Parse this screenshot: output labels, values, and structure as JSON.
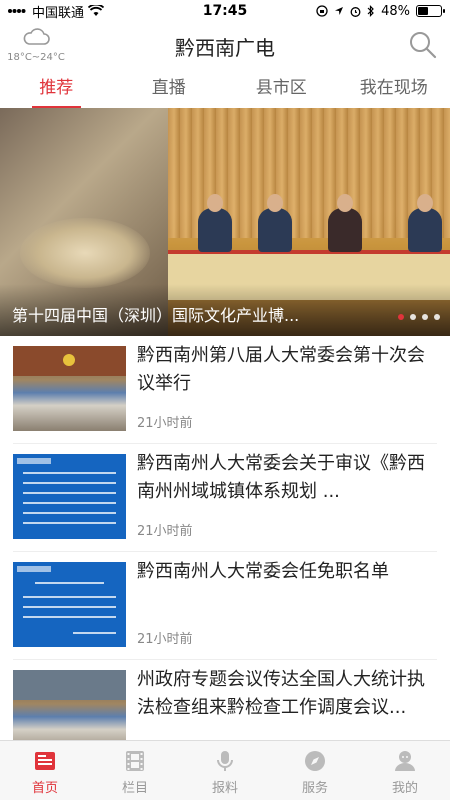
{
  "status_bar": {
    "carrier": "中国联通",
    "time": "17:45",
    "battery": "48%",
    "battery_level": 0.48
  },
  "header": {
    "title": "黔西南广电",
    "weather_icon": "cloud-icon",
    "temperature": "18°C~24°C"
  },
  "tabs": [
    {
      "label": "推荐",
      "active": true
    },
    {
      "label": "直播",
      "active": false
    },
    {
      "label": "县市区",
      "active": false
    },
    {
      "label": "我在现场",
      "active": false
    }
  ],
  "hero": {
    "title": "第十四届中国（深圳）国际文化产业博...",
    "dot_count": 4,
    "active_dot": 0
  },
  "news": [
    {
      "title": "黔西南州第八届人大常委会第十次会议举行",
      "time": "21小时前",
      "thumb": "meeting-photo"
    },
    {
      "title": "黔西南州人大常委会关于审议《黔西南州州域城镇体系规划 ...",
      "time": "21小时前",
      "thumb": "blue-document"
    },
    {
      "title": "黔西南州人大常委会任免职名单",
      "time": "21小时前",
      "thumb": "blue-document"
    },
    {
      "title": "州政府专题会议传达全国人大统计执法检查组来黔检查工作调度会议...",
      "time": "",
      "thumb": "meeting-photo"
    }
  ],
  "bottom_nav": [
    {
      "label": "首页",
      "icon": "home-news-icon",
      "active": true
    },
    {
      "label": "栏目",
      "icon": "film-icon",
      "active": false
    },
    {
      "label": "报料",
      "icon": "microphone-icon",
      "active": false
    },
    {
      "label": "服务",
      "icon": "compass-icon",
      "active": false
    },
    {
      "label": "我的",
      "icon": "user-icon",
      "active": false
    }
  ],
  "colors": {
    "accent": "#e0343b",
    "doc_blue": "#1565c0"
  }
}
